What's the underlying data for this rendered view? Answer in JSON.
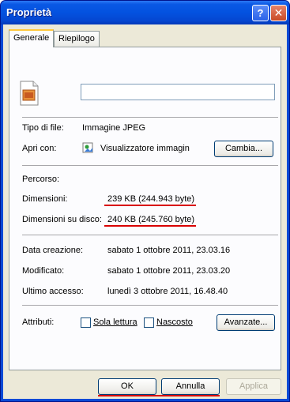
{
  "window": {
    "title": "Proprietà"
  },
  "tabs": [
    {
      "label": "Generale"
    },
    {
      "label": "Riepilogo"
    }
  ],
  "file": {
    "name": "",
    "type_label": "Tipo di file:",
    "type_value": "Immagine JPEG",
    "opens_label": "Apri con:",
    "opens_value": "Visualizzatore immagin",
    "change_button": "Cambia..."
  },
  "location": {
    "label": "Percorso:"
  },
  "size": {
    "label": "Dimensioni:",
    "value": "239 KB (244.943 byte)",
    "disk_label": "Dimensioni su disco:",
    "disk_value": "240 KB (245.760 byte)"
  },
  "dates": {
    "created_label": "Data creazione:",
    "created_value": "sabato 1 ottobre 2011, 23.03.16",
    "modified_label": "Modificato:",
    "modified_value": "sabato 1 ottobre 2011, 23.03.20",
    "accessed_label": "Ultimo accesso:",
    "accessed_value": "lunedì 3 ottobre 2011, 16.48.40"
  },
  "attributes": {
    "label": "Attributi:",
    "readonly": "Sola lettura",
    "hidden": "Nascosto",
    "advanced_button": "Avanzate..."
  },
  "footer": {
    "ok": "OK",
    "cancel": "Annulla",
    "apply": "Applica"
  },
  "colors": {
    "annotation": "#d90000",
    "titlebar": "#0352e0"
  }
}
